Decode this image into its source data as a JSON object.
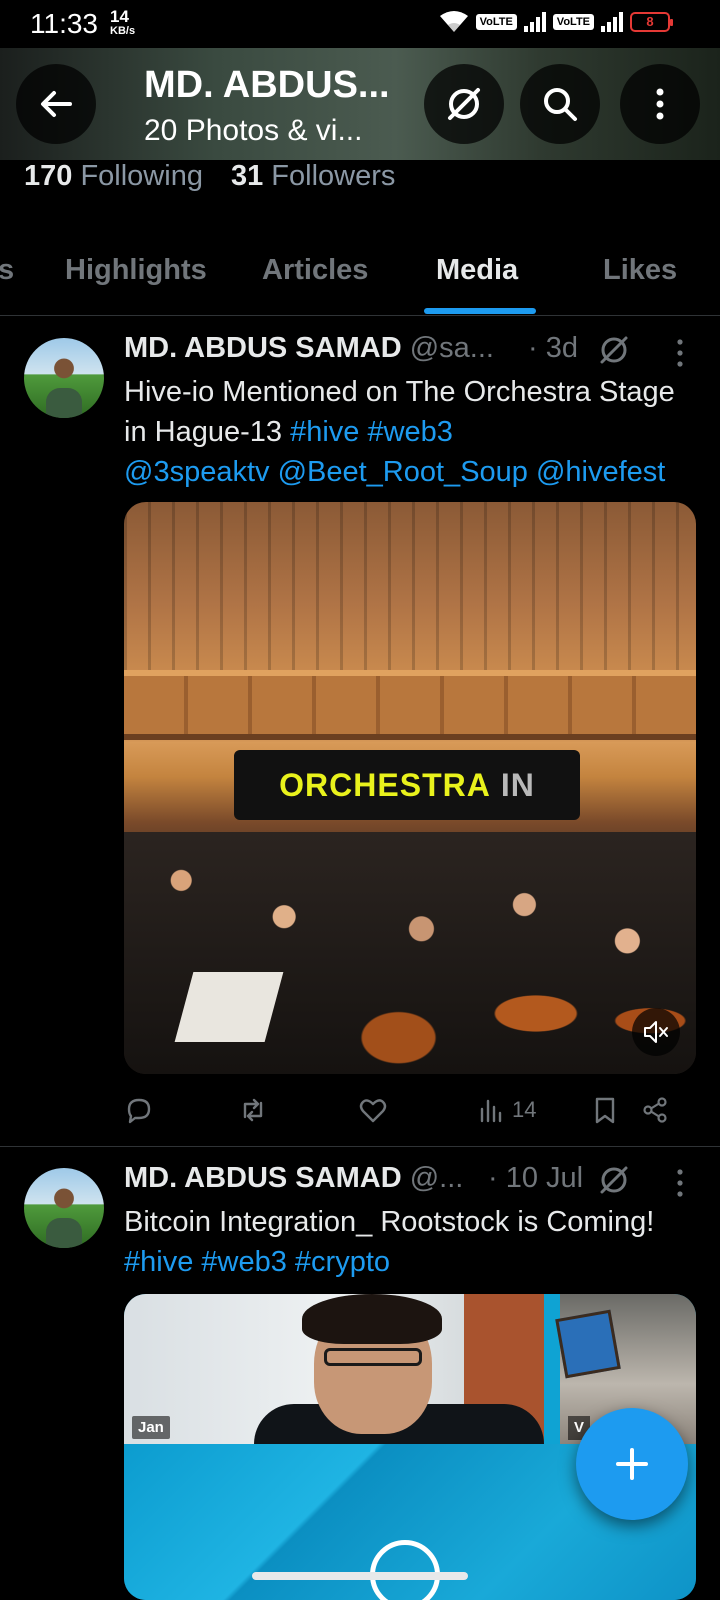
{
  "status_bar": {
    "time": "11:33",
    "speed_value": "14",
    "speed_unit": "KB/s",
    "volte1": "VoLTE",
    "volte2": "VoLTE",
    "battery": "8"
  },
  "header": {
    "title": "MD. ABDUS...",
    "subtitle": "20 Photos & vi..."
  },
  "profile": {
    "following_count": "170",
    "following_label": "Following",
    "followers_count": "31",
    "followers_label": "Followers"
  },
  "tabs": [
    {
      "label": "s",
      "active": false
    },
    {
      "label": "Highlights",
      "active": false
    },
    {
      "label": "Articles",
      "active": false
    },
    {
      "label": "Media",
      "active": true
    },
    {
      "label": "Likes",
      "active": false
    }
  ],
  "posts": [
    {
      "name": "MD. ABDUS SAMAD",
      "handle": "@sa...",
      "time": "· 3d",
      "text": "Hive-io Mentioned on The Orchestra Stage in Hague-13 ",
      "tags": [
        "#hive",
        "#web3"
      ],
      "mentions": [
        "@3speaktv",
        "@Beet_Root_Soup",
        "@hivefest"
      ],
      "media_banner": {
        "main": "ORCHESTRA",
        "dim": "IN"
      },
      "views": "14"
    },
    {
      "name": "MD. ABDUS SAMAD",
      "handle": "@...",
      "time": "· 10 Jul",
      "text": "Bitcoin Integration_ Rootstock is Coming!",
      "tags": [
        "#hive",
        "#web3",
        "#crypto"
      ],
      "video_labels": {
        "left": "Jan",
        "right": "V"
      }
    }
  ],
  "colors": {
    "accent": "#1d9bf0",
    "muted": "#71767b",
    "text": "#e7e9ea",
    "background": "#000000"
  },
  "icons": [
    "back-arrow-icon",
    "grok-icon",
    "search-icon",
    "more-vertical-icon",
    "reply-icon",
    "repost-icon",
    "like-icon",
    "views-icon",
    "bookmark-icon",
    "share-icon",
    "mute-icon",
    "plus-icon"
  ]
}
